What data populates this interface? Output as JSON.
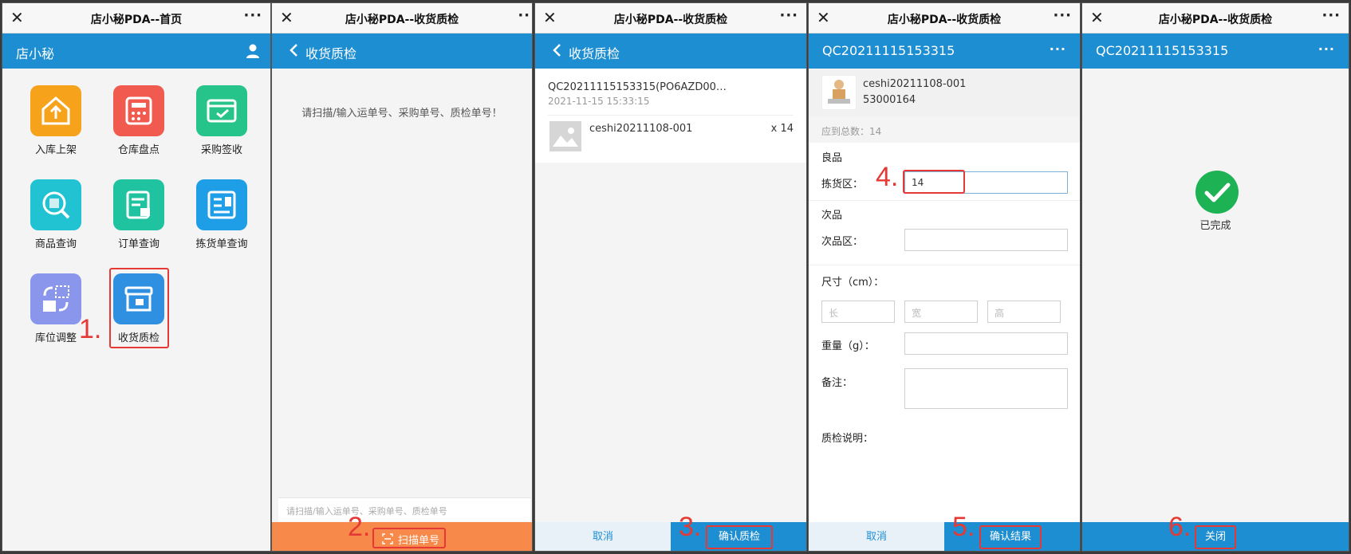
{
  "app_title": "店小秘PDA--首页",
  "qc_title": "店小秘PDA--收货质检",
  "panel1": {
    "nav_title": "店小秘",
    "tiles": [
      {
        "label": "入库上架",
        "color": "#f7a21b"
      },
      {
        "label": "仓库盘点",
        "color": "#f05a4f"
      },
      {
        "label": "采购签收",
        "color": "#26c48a"
      },
      {
        "label": "商品查询",
        "color": "#21c2d2"
      },
      {
        "label": "订单查询",
        "color": "#1fc3a0"
      },
      {
        "label": "拣货单查询",
        "color": "#1f9ee8"
      },
      {
        "label": "库位调整",
        "color": "#8a95ec"
      },
      {
        "label": "收货质检",
        "color": "#2f8fe0"
      }
    ],
    "step": "1."
  },
  "panel2": {
    "nav_title": "收货质检",
    "hint": "请扫描/输入运单号、采购单号、质检单号！",
    "input_placeholder": "请扫描/输入运单号、采购单号、质检单号",
    "scan_label": "扫描单号",
    "step": "2."
  },
  "panel3": {
    "nav_title": "收货质检",
    "order_no": "QC20211115153315(PO6AZD00…",
    "order_time": "2021-11-15 15:33:15",
    "item_name": "ceshi20211108-001",
    "item_qty": "x 14",
    "cancel_label": "取消",
    "confirm_label": "确认质检",
    "step": "3."
  },
  "panel4": {
    "nav_title": "QC20211115153315",
    "sku_name": "ceshi20211108-001",
    "sku_code": "53000164",
    "total": "应到总数：14",
    "good_title": "良品",
    "pick_area_label": "拣货区：",
    "pick_area_value": "14",
    "defect_title": "次品",
    "defect_area_label": "次品区：",
    "size_label": "尺寸（cm）：",
    "len_ph": "长",
    "wid_ph": "宽",
    "hei_ph": "高",
    "weight_label": "重量（g）：",
    "remark_label": "备注：",
    "qc_note_label": "质检说明：",
    "cancel_label": "取消",
    "confirm_label": "确认结果",
    "step4": "4.",
    "step5": "5."
  },
  "panel5": {
    "nav_title": "QC20211115153315",
    "done_label": "已完成",
    "close_label": "关闭",
    "step": "6."
  }
}
